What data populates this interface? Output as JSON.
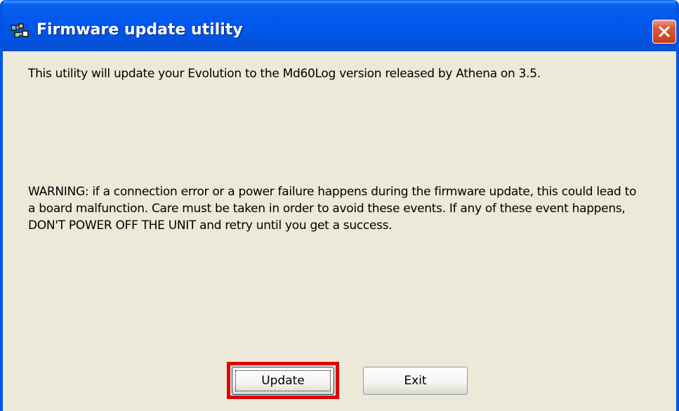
{
  "window": {
    "title": "Firmware update utility",
    "app_icon": "app-icon",
    "close_icon": "close-icon"
  },
  "content": {
    "intro": "This utility will update your Evolution to the Md60Log version released by Athena on 3.5.",
    "warning": "WARNING: if a connection error or a power failure happens during the firmware update, this could lead to a board malfunction. Care must be taken in order to avoid these events. If any of these event happens, DON'T POWER OFF THE UNIT and retry until you get a success."
  },
  "buttons": {
    "update_label": "Update",
    "exit_label": "Exit"
  },
  "colors": {
    "titlebar": "#0054e3",
    "face": "#ece9d8",
    "highlight": "#e00000",
    "close": "#d44a2a"
  }
}
